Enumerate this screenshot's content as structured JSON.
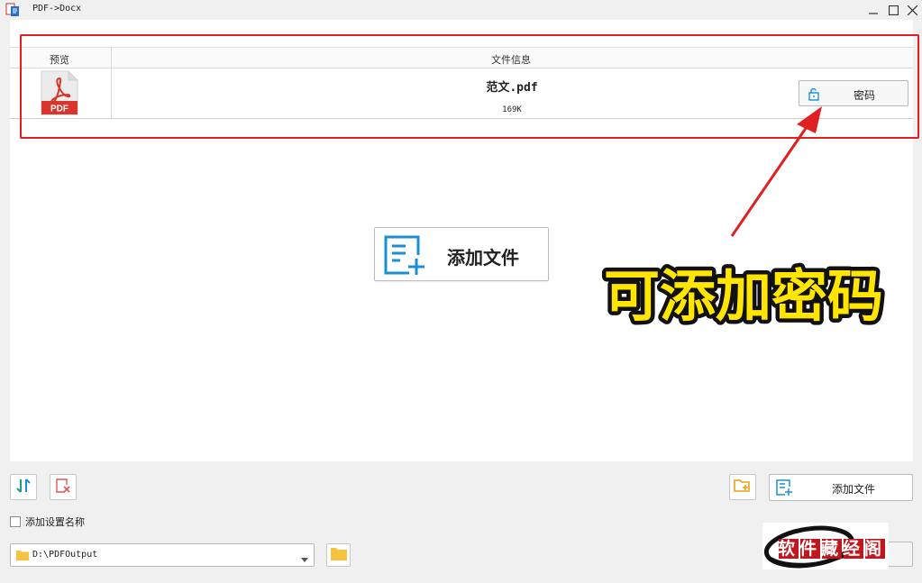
{
  "window": {
    "title": "PDF->Docx"
  },
  "table": {
    "col_preview": "预览",
    "col_info": "文件信息",
    "rows": [
      {
        "thumb_label": "PDF",
        "name": "范文.pdf",
        "size": "169K",
        "password_label": "密码"
      }
    ]
  },
  "main": {
    "add_file_label": "添加文件"
  },
  "annotation": {
    "caption": "可添加密码",
    "color": "#e02020"
  },
  "toolbar": {
    "add_file_label": "添加文件",
    "add_name_label": "添加设置名称",
    "output_path": "D:\\PDFOutput"
  },
  "watermark": {
    "text": "软件藏经阁"
  },
  "colors": {
    "accent": "#1a8fd6",
    "pdf_red": "#d9362b",
    "folder": "#f5c242",
    "highlight": "#e02020",
    "caption_fill": "#ffe500"
  }
}
